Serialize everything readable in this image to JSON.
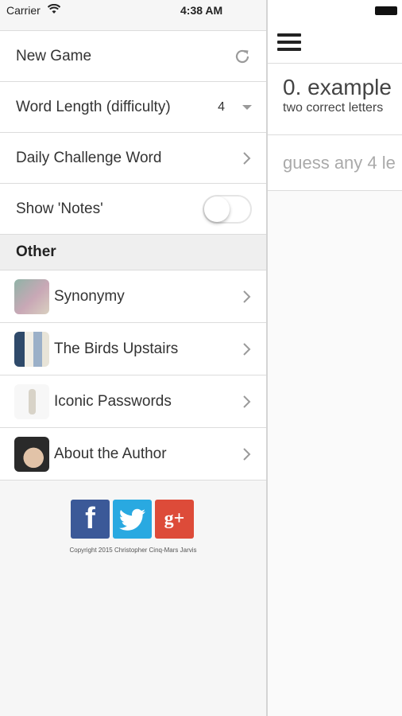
{
  "status": {
    "carrier": "Carrier",
    "time": "4:38 AM"
  },
  "menu": {
    "new_game": "New Game",
    "word_length_label": "Word Length (difficulty)",
    "word_length_value": "4",
    "daily_challenge": "Daily Challenge Word",
    "show_notes": "Show 'Notes'",
    "show_notes_on": false
  },
  "other": {
    "header": "Other",
    "items": [
      {
        "label": "Synonymy",
        "icon": "synonymy-app-icon"
      },
      {
        "label": "The Birds Upstairs",
        "icon": "birds-upstairs-app-icon"
      },
      {
        "label": "Iconic Passwords",
        "icon": "iconic-passwords-app-icon"
      },
      {
        "label": "About the Author",
        "icon": "author-avatar"
      }
    ]
  },
  "social": {
    "facebook": "f",
    "googleplus": "g+",
    "copyright": "Copyright 2015 Christopher Cinq-Mars Jarvis"
  },
  "main": {
    "example_title": "0. example",
    "example_sub": "two correct letters",
    "guess_placeholder": "guess any 4 le"
  },
  "colors": {
    "facebook": "#3b5998",
    "twitter": "#29a9e1",
    "googleplus": "#dd4b39"
  }
}
